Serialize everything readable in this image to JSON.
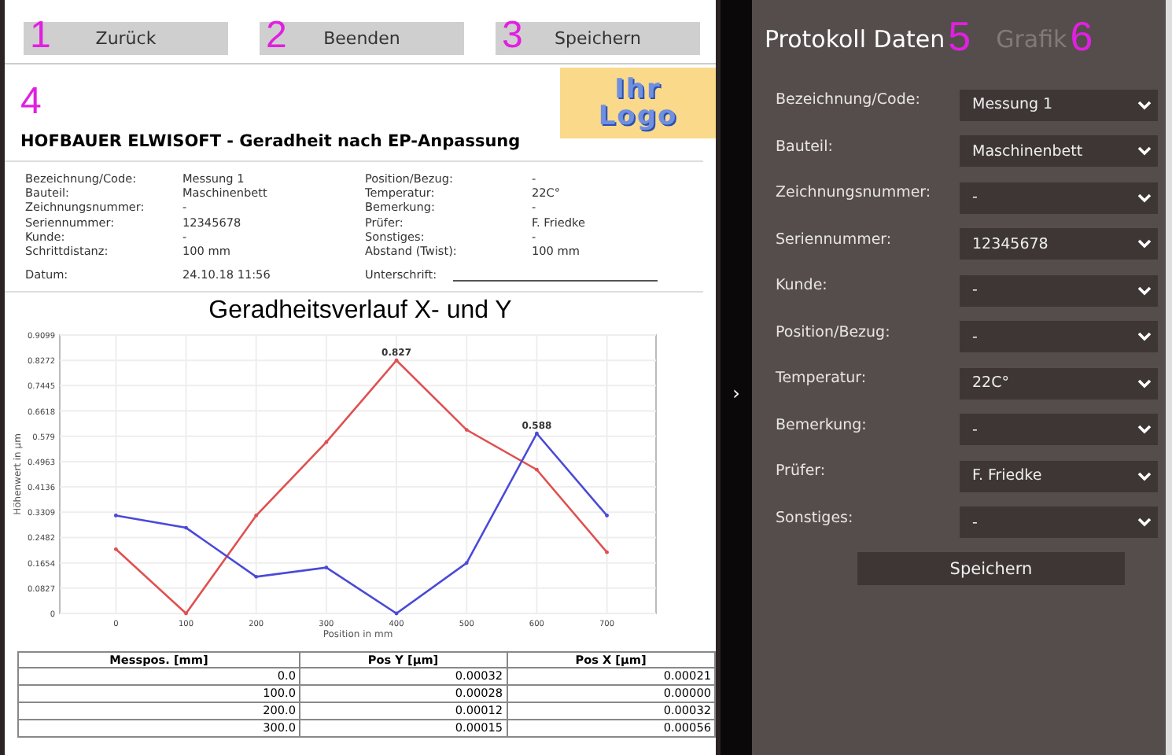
{
  "toolbar": {
    "buttons": [
      {
        "marker": "1",
        "label": "Zurück"
      },
      {
        "marker": "2",
        "label": "Beenden"
      },
      {
        "marker": "3",
        "label": "Speichern"
      }
    ]
  },
  "report": {
    "marker": "4",
    "logo": {
      "line_1": "Ihr",
      "line_2": "Logo"
    },
    "title": "HOFBAUER ELWISOFT - Geradheit nach EP-Anpassung",
    "fields_left": [
      {
        "label": "Bezeichnung/Code:",
        "value": "Messung 1"
      },
      {
        "label": "Bauteil:",
        "value": "Maschinenbett"
      },
      {
        "label": "Zeichnungsnummer:",
        "value": "-"
      },
      {
        "label": "Seriennummer:",
        "value": "12345678"
      },
      {
        "label": "Kunde:",
        "value": "-"
      },
      {
        "label": "Schrittdistanz:",
        "value": "100 mm"
      }
    ],
    "fields_right": [
      {
        "label": "Position/Bezug:",
        "value": "-"
      },
      {
        "label": "Temperatur:",
        "value": "22C°"
      },
      {
        "label": "Bemerkung:",
        "value": "-"
      },
      {
        "label": "Prüfer:",
        "value": "F. Friedke"
      },
      {
        "label": "Sonstiges:",
        "value": "-"
      },
      {
        "label": "Abstand (Twist):",
        "value": "100 mm"
      }
    ],
    "date": {
      "label": "Datum:",
      "value": "24.10.18 11:56"
    },
    "signature": {
      "label": "Unterschrift:"
    },
    "chart_title": "Geradheitsverlauf X- und Y",
    "chart_data": {
      "type": "line",
      "xlabel": "Position in mm",
      "ylabel": "Höhenwert in µm",
      "x": [
        0,
        100,
        200,
        300,
        400,
        500,
        600,
        700
      ],
      "grid": true,
      "series": [
        {
          "color": "#e05050",
          "values": [
            0.21,
            0.0,
            0.32,
            0.56,
            0.827,
            0.6,
            0.47,
            0.2
          ]
        },
        {
          "color": "#4a4ad8",
          "values": [
            0.32,
            0.28,
            0.12,
            0.15,
            0.0,
            0.165,
            0.588,
            0.32
          ]
        }
      ],
      "xlim": [
        -80,
        770
      ],
      "ylim": [
        0,
        0.9099
      ],
      "xticks": [
        0,
        100,
        200,
        300,
        400,
        500,
        600,
        700
      ],
      "yticks": [
        {
          "value": 0,
          "label": "0"
        },
        {
          "value": 0.0827,
          "label": "0.0827"
        },
        {
          "value": 0.1654,
          "label": "0.1654"
        },
        {
          "value": 0.2482,
          "label": "0.2482"
        },
        {
          "value": 0.3309,
          "label": "0.3309"
        },
        {
          "value": 0.4136,
          "label": "0.4136"
        },
        {
          "value": 0.4963,
          "label": "0.4963"
        },
        {
          "value": 0.579,
          "label": "0.579"
        },
        {
          "value": 0.6618,
          "label": "0.6618"
        },
        {
          "value": 0.7445,
          "label": "0.7445"
        },
        {
          "value": 0.8272,
          "label": "0.8272"
        },
        {
          "value": 0.9099,
          "label": "0.9099"
        }
      ],
      "annotations": [
        {
          "x": 400,
          "y": 0.827,
          "text": "0.827"
        },
        {
          "x": 600,
          "y": 0.588,
          "text": "0.588"
        }
      ]
    },
    "table": {
      "columns": [
        "Messpos. [mm]",
        "Pos Y [µm]",
        "Pos X [µm]"
      ],
      "rows": [
        [
          "0.0",
          "0.00032",
          "0.00021"
        ],
        [
          "100.0",
          "0.00028",
          "0.00000"
        ],
        [
          "200.0",
          "0.00012",
          "0.00032"
        ],
        [
          "300.0",
          "0.00015",
          "0.00056"
        ]
      ]
    }
  },
  "side_panel": {
    "toggle": "›",
    "tabs": [
      {
        "label": "Protokoll Daten",
        "marker": "5",
        "selected": true
      },
      {
        "label": "Grafik",
        "marker": "6",
        "selected": false
      }
    ],
    "fields": [
      {
        "label": "Bezeichnung/Code:",
        "value": "Messung 1"
      },
      {
        "label": "Bauteil:",
        "value": "Maschinenbett"
      },
      {
        "label": "Zeichnungsnummer:",
        "value": "-"
      },
      {
        "label": "Seriennummer:",
        "value": "12345678"
      },
      {
        "label": "Kunde:",
        "value": "-"
      },
      {
        "label": "Position/Bezug:",
        "value": "-"
      },
      {
        "label": "Temperatur:",
        "value": "22C°"
      },
      {
        "label": "Bemerkung:",
        "value": "-"
      },
      {
        "label": "Prüfer:",
        "value": "F. Friedke"
      },
      {
        "label": "Sonstiges:",
        "value": "-"
      }
    ],
    "save_button": "Speichern"
  }
}
